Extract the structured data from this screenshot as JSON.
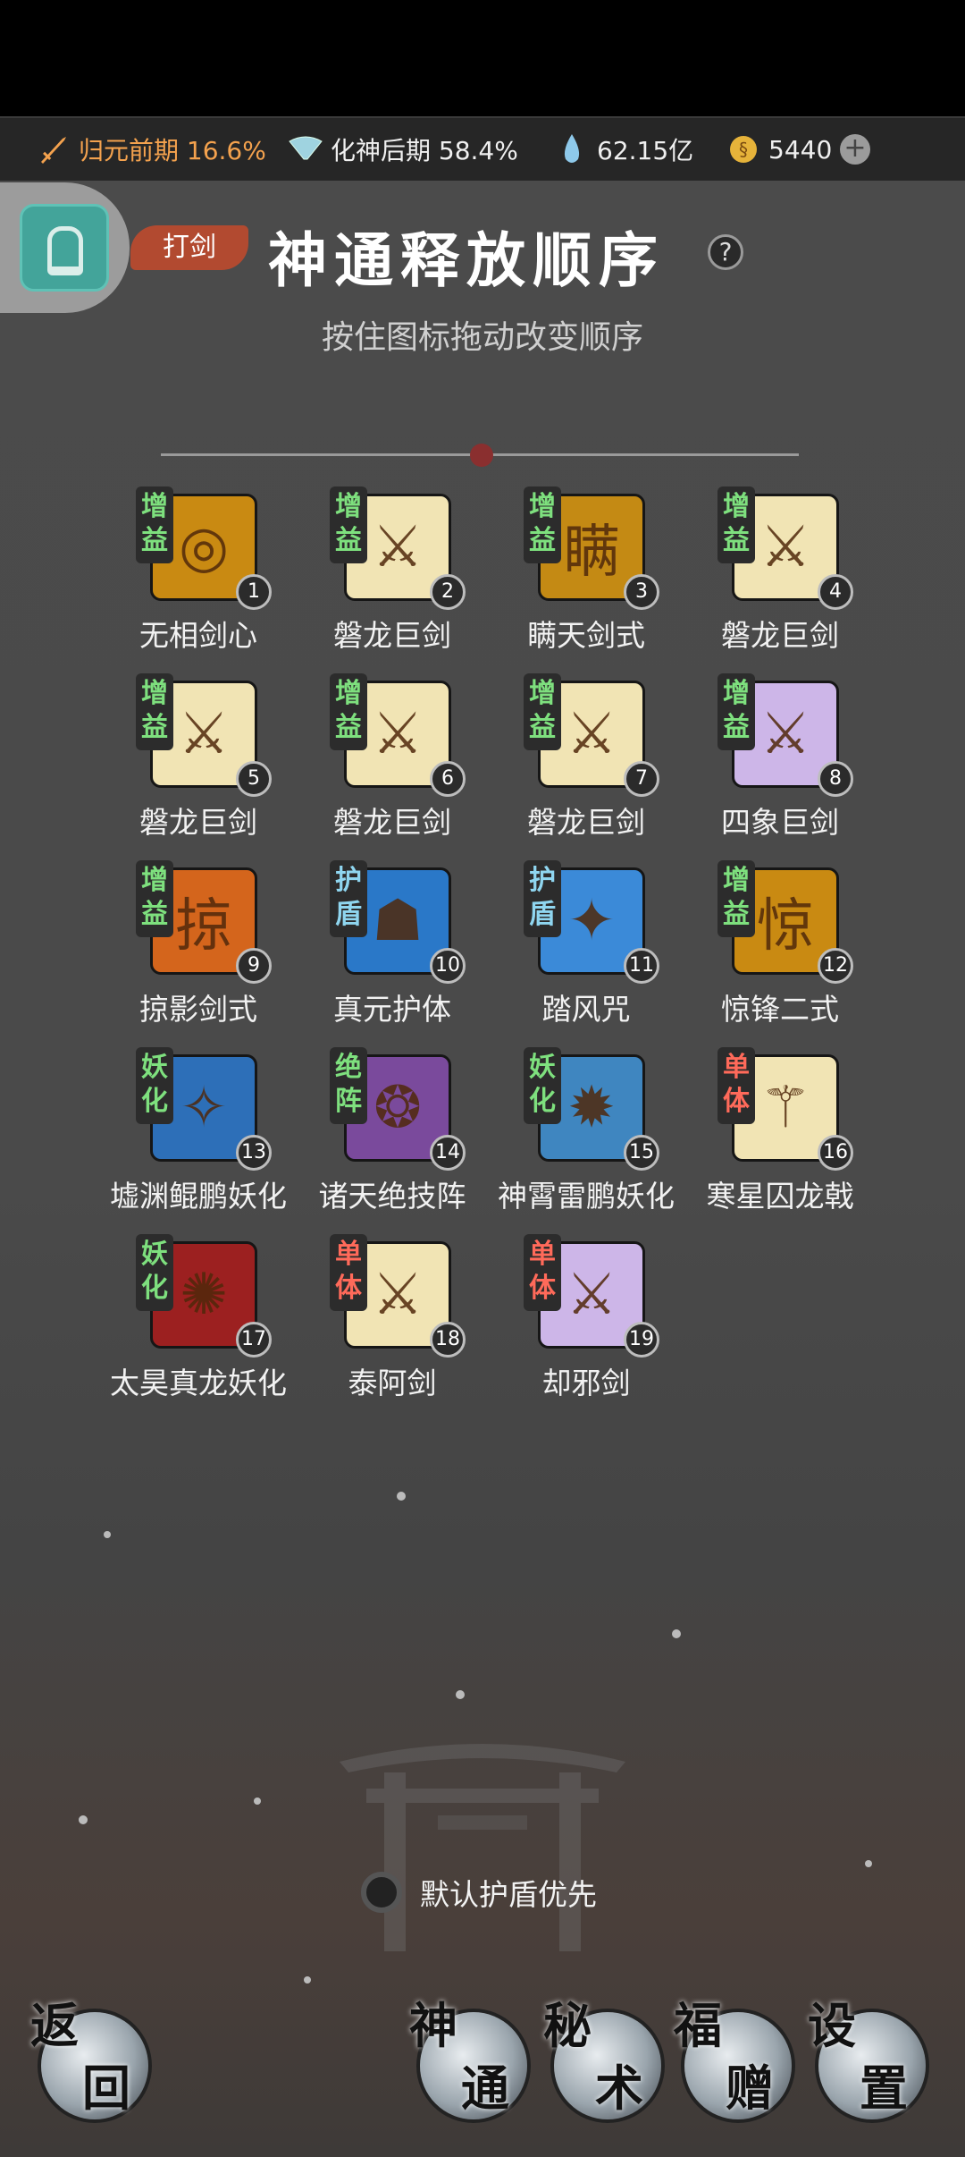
{
  "resources": {
    "realm1": "归元前期 16.6%",
    "realm2": "化神后期 58.4%",
    "spirit_stones": "62.15亿",
    "coins": "5440"
  },
  "header": {
    "tag": "打剑",
    "title": "神通释放顺序",
    "help": "?",
    "subtitle": "按住图标拖动改变顺序"
  },
  "skills": [
    {
      "name": "无相剑心",
      "type": "增益",
      "num": "1",
      "bg": "#c98a12",
      "glyph": "◎"
    },
    {
      "name": "磐龙巨剑",
      "type": "增益",
      "num": "2",
      "bg": "#f1e4b4",
      "glyph": "⚔"
    },
    {
      "name": "瞒天剑式",
      "type": "增益",
      "num": "3",
      "bg": "#c48a14",
      "glyph": "瞒"
    },
    {
      "name": "磐龙巨剑",
      "type": "增益",
      "num": "4",
      "bg": "#f1e4b4",
      "glyph": "⚔"
    },
    {
      "name": "磐龙巨剑",
      "type": "增益",
      "num": "5",
      "bg": "#f1e4b4",
      "glyph": "⚔"
    },
    {
      "name": "磐龙巨剑",
      "type": "增益",
      "num": "6",
      "bg": "#f1e4b4",
      "glyph": "⚔"
    },
    {
      "name": "磐龙巨剑",
      "type": "增益",
      "num": "7",
      "bg": "#f1e4b4",
      "glyph": "⚔"
    },
    {
      "name": "四象巨剑",
      "type": "增益",
      "num": "8",
      "bg": "#cdb6e8",
      "glyph": "⚔"
    },
    {
      "name": "掠影剑式",
      "type": "增益",
      "num": "9",
      "bg": "#d4651c",
      "glyph": "掠"
    },
    {
      "name": "真元护体",
      "type": "护盾",
      "num": "10",
      "bg": "#2a78c8",
      "glyph": "☗"
    },
    {
      "name": "踏风咒",
      "type": "护盾",
      "num": "11",
      "bg": "#3b8ad8",
      "glyph": "✦"
    },
    {
      "name": "惊锋二式",
      "type": "增益",
      "num": "12",
      "bg": "#c98a12",
      "glyph": "惊"
    },
    {
      "name": "墟渊鲲鹏妖化",
      "type": "妖化",
      "num": "13",
      "bg": "#2d6fb8",
      "glyph": "✧"
    },
    {
      "name": "诸天绝技阵",
      "type": "绝阵",
      "num": "14",
      "bg": "#7a4a9c",
      "glyph": "❂"
    },
    {
      "name": "神霄雷鹏妖化",
      "type": "妖化",
      "num": "15",
      "bg": "#3f86c0",
      "glyph": "✹"
    },
    {
      "name": "寒星囚龙戟",
      "type": "单体",
      "num": "16",
      "bg": "#f1e4b4",
      "glyph": "⚚"
    },
    {
      "name": "太昊真龙妖化",
      "type": "妖化",
      "num": "17",
      "bg": "#9c2020",
      "glyph": "✺"
    },
    {
      "name": "泰阿剑",
      "type": "单体",
      "num": "18",
      "bg": "#f1e4b4",
      "glyph": "⚔"
    },
    {
      "name": "却邪剑",
      "type": "单体",
      "num": "19",
      "bg": "#cdb6e8",
      "glyph": "⚔"
    }
  ],
  "type_colors": {
    "增益": "#7ee07e",
    "护盾": "#8fd6f0",
    "妖化": "#7ee07e",
    "绝阵": "#7ee07e",
    "单体": "#ff6a5a"
  },
  "option": {
    "shield_first": "默认护盾优先"
  },
  "bottom_nav": [
    {
      "t1": "返",
      "t2": "回"
    },
    {
      "t1": "神",
      "t2": "通"
    },
    {
      "t1": "秘",
      "t2": "术"
    },
    {
      "t1": "福",
      "t2": "赠"
    },
    {
      "t1": "设",
      "t2": "置"
    }
  ]
}
